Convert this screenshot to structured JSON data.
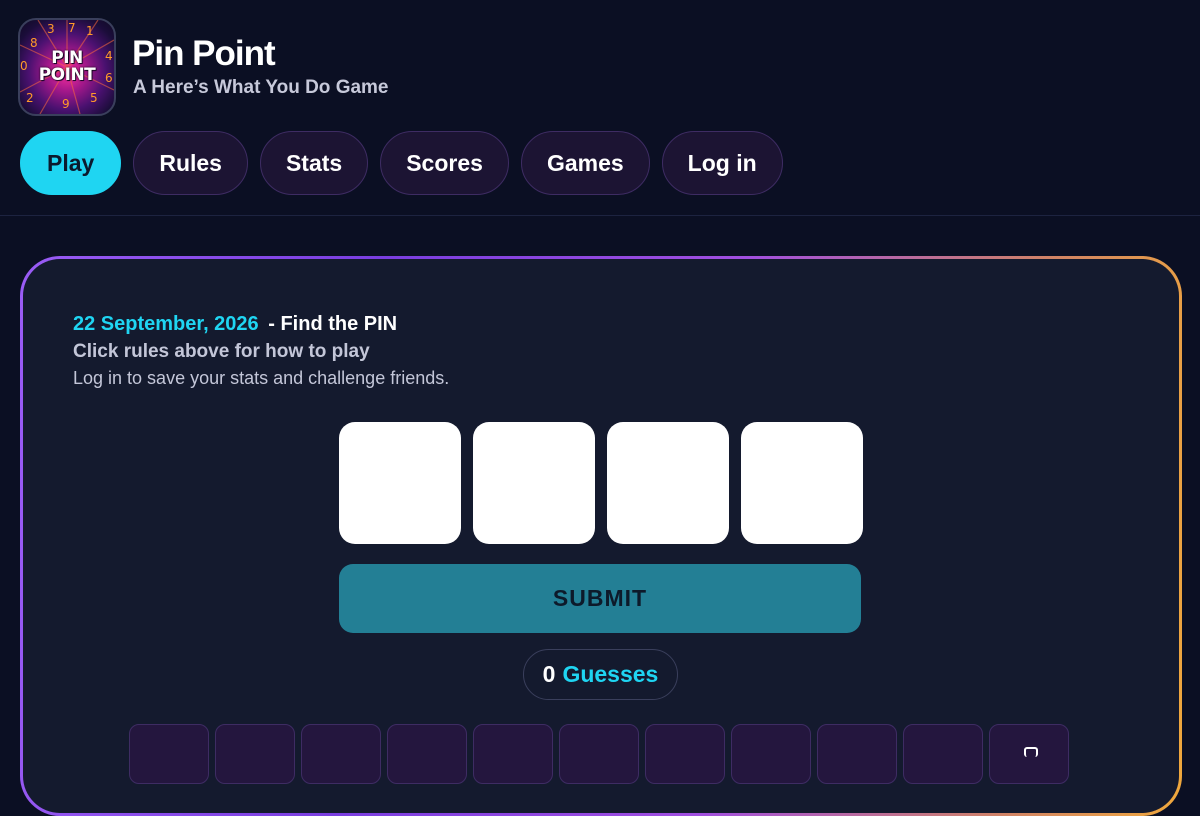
{
  "app": {
    "logo_line1": "PIN",
    "logo_line2": "POINT",
    "logo_digits": [
      "8",
      "3",
      "7",
      "1",
      "0",
      "4",
      "6",
      "2",
      "9",
      "5"
    ],
    "title": "Pin Point",
    "subtitle": "A Here’s What You Do Game"
  },
  "nav": {
    "items": [
      {
        "label": "Play",
        "active": true
      },
      {
        "label": "Rules",
        "active": false
      },
      {
        "label": "Stats",
        "active": false
      },
      {
        "label": "Scores",
        "active": false
      },
      {
        "label": "Games",
        "active": false
      },
      {
        "label": "Log in",
        "active": false
      }
    ]
  },
  "game": {
    "date": "22 September, 2026",
    "find_label": "- Find the PIN",
    "rules_hint": "Click rules above for how to play",
    "login_hint": "Log in to save your stats and challenge friends.",
    "pin_digits": [
      "",
      "",
      "",
      ""
    ],
    "submit_label": "SUBMIT",
    "guess_count": "0",
    "guess_word": "Guesses"
  },
  "colors": {
    "background": "#0b0f23",
    "accent": "#1fd5f2",
    "submit": "#237f95",
    "card": "#141a2e",
    "button": "#1c1433"
  },
  "keypad": {
    "icons": [
      "",
      "",
      "",
      "",
      "",
      "",
      "",
      "",
      "",
      "",
      "backspace-icon"
    ]
  }
}
